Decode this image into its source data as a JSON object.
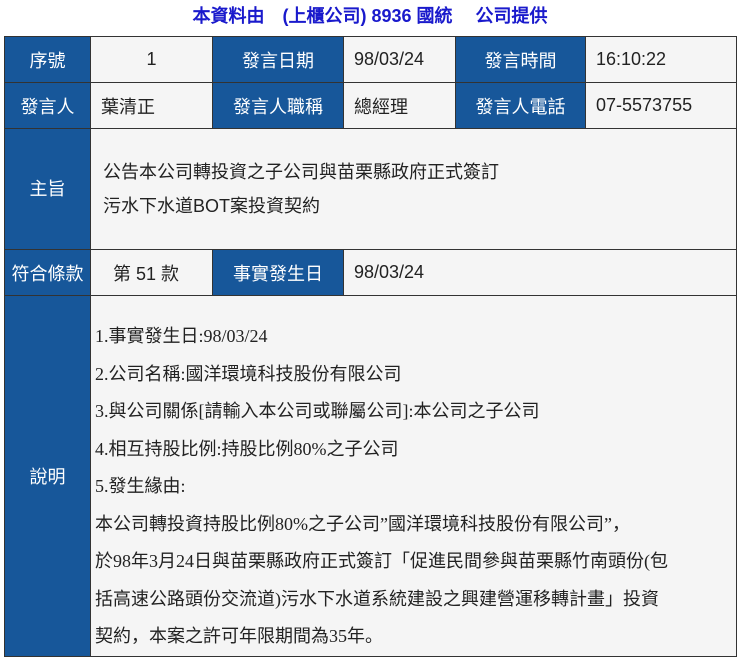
{
  "header": {
    "title": "本資料由　(上櫃公司) 8936 國統　 公司提供"
  },
  "labels": {
    "seq": "序號",
    "date": "發言日期",
    "time": "發言時間",
    "speaker": "發言人",
    "title": "發言人職稱",
    "phone": "發言人電話",
    "subject": "主旨",
    "clause": "符合條款",
    "fact_date": "事實發生日",
    "desc": "說明"
  },
  "values": {
    "seq": "1",
    "date": "98/03/24",
    "time": "16:10:22",
    "speaker": "葉清正",
    "title": "總經理",
    "phone": "07-5573755",
    "subject_lines": [
      "公告本公司轉投資之子公司與苗栗縣政府正式簽訂",
      "污水下水道BOT案投資契約"
    ],
    "clause": "第 51 款",
    "fact_date": "98/03/24"
  },
  "description": [
    "1.事實發生日:98/03/24",
    "2.公司名稱:國洋環境科技股份有限公司",
    "3.與公司關係[請輸入本公司或聯屬公司]:本公司之子公司",
    "4.相互持股比例:持股比例80%之子公司",
    "5.發生緣由:",
    "本公司轉投資持股比例80%之子公司”國洋環境科技股份有限公司”，",
    "於98年3月24日與苗栗縣政府正式簽訂「促進民間參與苗栗縣竹南頭份(包",
    "括高速公路頭份交流道)污水下水道系統建設之興建營運移轉計畫」投資",
    "契約，本案之許可年限期間為35年。"
  ]
}
